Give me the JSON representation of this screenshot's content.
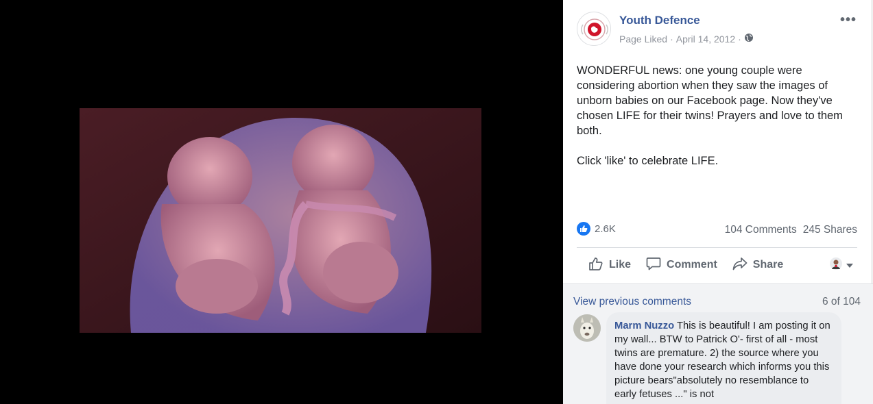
{
  "post": {
    "page_name": "Youth Defence",
    "page_liked": "Page Liked",
    "sep": "·",
    "date": "April 14, 2012",
    "more_label": "•••",
    "text_paragraph_1": "WONDERFUL news: one young couple were considering abortion when they saw the images of unborn babies on our Facebook page. Now they've chosen LIFE for their twins! Prayers and love to them both.",
    "text_paragraph_2": "Click 'like' to celebrate LIFE.",
    "like_count": "2.6K",
    "comments_count": "104 Comments",
    "shares_count": "245 Shares"
  },
  "actions": {
    "like": "Like",
    "comment": "Comment",
    "share": "Share"
  },
  "comments": {
    "view_previous": "View previous comments",
    "position": "6 of 104",
    "items": [
      {
        "author": "Marm Nuzzo",
        "text": "This is beautiful! I am posting it on my wall... BTW to Patrick O'- first of all - most twins are premature. 2) the source where you have done your research which informs you this picture bears\"absolutely no resemblance to early fetuses ...\" is not"
      }
    ]
  },
  "colors": {
    "link": "#385898",
    "meta": "#90949c",
    "like_blue": "#1877f2",
    "brand_red": "#d0142a"
  },
  "icons": {
    "page_avatar": "youth-defence-logo-icon",
    "privacy": "globe-icon",
    "like_action": "thumbs-up-icon",
    "comment_action": "comment-bubble-icon",
    "share_action": "share-arrow-icon",
    "react_as": "profile-avatar-icon",
    "dropdown": "caret-down-icon"
  }
}
